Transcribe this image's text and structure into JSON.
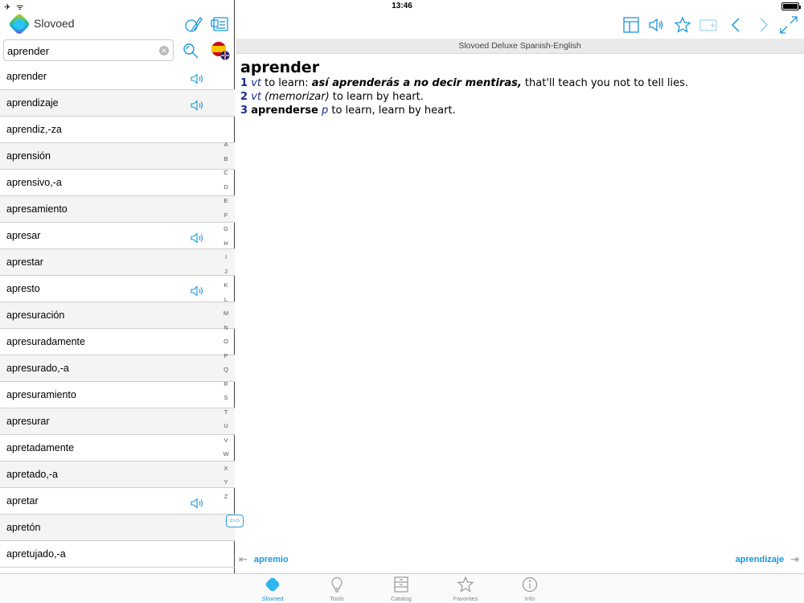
{
  "status_bar": {
    "time": "13:46",
    "left_symbols": "✈ ᯤ"
  },
  "app": {
    "name": "Slovoed"
  },
  "search": {
    "value": "aprender",
    "placeholder": ""
  },
  "word_list": [
    {
      "word": "aprender",
      "audio": true
    },
    {
      "word": "aprendizaje",
      "audio": true
    },
    {
      "word": "aprendiz,-za",
      "audio": false
    },
    {
      "word": "aprensión",
      "audio": false
    },
    {
      "word": "aprensivo,-a",
      "audio": false
    },
    {
      "word": "apresamiento",
      "audio": false
    },
    {
      "word": "apresar",
      "audio": true
    },
    {
      "word": "aprestar",
      "audio": false
    },
    {
      "word": "apresto",
      "audio": true
    },
    {
      "word": "apresuración",
      "audio": false
    },
    {
      "word": "apresuradamente",
      "audio": false
    },
    {
      "word": "apresurado,-a",
      "audio": false
    },
    {
      "word": "apresuramiento",
      "audio": false
    },
    {
      "word": "apresurar",
      "audio": false
    },
    {
      "word": "apretadamente",
      "audio": false
    },
    {
      "word": "apretado,-a",
      "audio": false
    },
    {
      "word": "apretar",
      "audio": true
    },
    {
      "word": "apretón",
      "audio": false
    },
    {
      "word": "apretujado,-a",
      "audio": false
    }
  ],
  "alphabet": [
    "A",
    "B",
    "C",
    "D",
    "E",
    "F",
    "G",
    "H",
    "I",
    "J",
    "K",
    "L",
    "M",
    "N",
    "O",
    "P",
    "Q",
    "R",
    "S",
    "T",
    "U",
    "V",
    "W",
    "X",
    "Y",
    "Z"
  ],
  "dictionary_title": "Slovoed Deluxe Spanish-English",
  "entry": {
    "headword": "aprender",
    "senses": [
      {
        "num": "1",
        "pos": "vt",
        "text1": "to learn:",
        "example": "así aprenderás a no decir mentiras,",
        "text2": "that'll teach you not to tell lies."
      },
      {
        "num": "2",
        "pos": "vt",
        "gloss": "(memorizar)",
        "text": "to learn by heart."
      },
      {
        "num": "3",
        "phrase": "aprenderse",
        "pos": "p",
        "text": "to learn, learn by heart."
      }
    ]
  },
  "navigation": {
    "prev": "apremio",
    "next": "aprendizaje"
  },
  "tabs": [
    {
      "label": "Slovoed",
      "icon": "slovoed-logo-icon",
      "active": true
    },
    {
      "label": "Tools",
      "icon": "lightbulb-icon",
      "active": false
    },
    {
      "label": "Catalog",
      "icon": "catalog-icon",
      "active": false
    },
    {
      "label": "Favorites",
      "icon": "star-icon",
      "active": false
    },
    {
      "label": "Info",
      "icon": "info-icon",
      "active": false
    }
  ],
  "colors": {
    "accent": "#1a96d8",
    "sense_number": "#1a2a8a",
    "row_alt": "#f4f4f4"
  }
}
